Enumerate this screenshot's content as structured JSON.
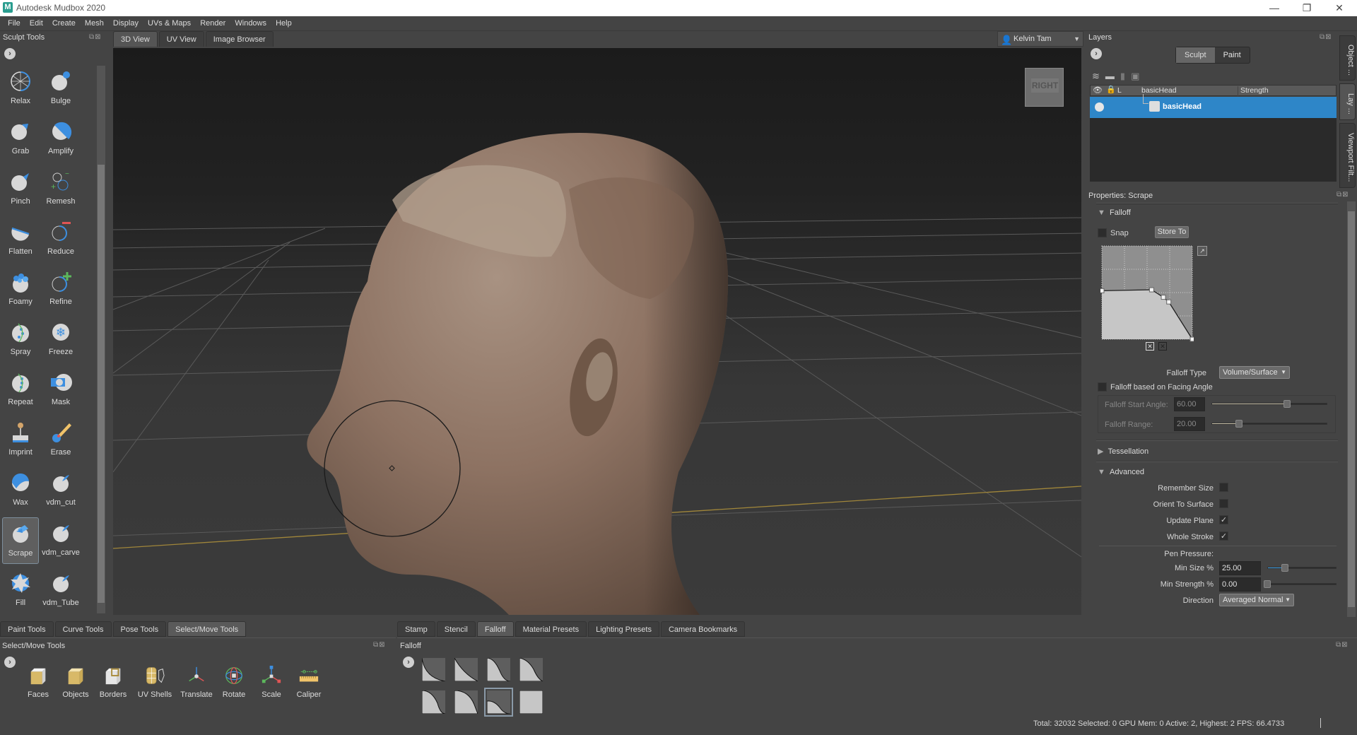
{
  "app": {
    "title": "Autodesk Mudbox 2020",
    "logo_letter": "M",
    "window_controls": {
      "minimize": "—",
      "restore": "❐",
      "close": "✕"
    }
  },
  "menu": [
    "File",
    "Edit",
    "Create",
    "Mesh",
    "Display",
    "UVs & Maps",
    "Render",
    "Windows",
    "Help"
  ],
  "sculpt_tools": {
    "title": "Sculpt Tools",
    "selected": "Scrape",
    "items": [
      {
        "label": "Relax",
        "icon": "relax-icon"
      },
      {
        "label": "Bulge",
        "icon": "bulge-icon"
      },
      {
        "label": "Grab",
        "icon": "grab-icon"
      },
      {
        "label": "Amplify",
        "icon": "amplify-icon"
      },
      {
        "label": "Pinch",
        "icon": "pinch-icon"
      },
      {
        "label": "Remesh",
        "icon": "remesh-icon"
      },
      {
        "label": "Flatten",
        "icon": "flatten-icon"
      },
      {
        "label": "Reduce",
        "icon": "reduce-icon"
      },
      {
        "label": "Foamy",
        "icon": "foamy-icon"
      },
      {
        "label": "Refine",
        "icon": "refine-icon"
      },
      {
        "label": "Spray",
        "icon": "spray-icon"
      },
      {
        "label": "Freeze",
        "icon": "freeze-icon"
      },
      {
        "label": "Repeat",
        "icon": "repeat-icon"
      },
      {
        "label": "Mask",
        "icon": "mask-icon"
      },
      {
        "label": "Imprint",
        "icon": "imprint-icon"
      },
      {
        "label": "Erase",
        "icon": "erase-icon"
      },
      {
        "label": "Wax",
        "icon": "wax-icon"
      },
      {
        "label": "vdm_cut",
        "icon": "vdm-cut-icon"
      },
      {
        "label": "Scrape",
        "icon": "scrape-icon"
      },
      {
        "label": "vdm_carve",
        "icon": "vdm-carve-icon"
      },
      {
        "label": "Fill",
        "icon": "fill-icon"
      },
      {
        "label": "vdm_Tube",
        "icon": "vdm-tube-icon"
      }
    ]
  },
  "viewport": {
    "tabs": [
      {
        "label": "3D View",
        "active": true
      },
      {
        "label": "UV View",
        "active": false
      },
      {
        "label": "Image Browser",
        "active": false
      }
    ],
    "user": "Kelvin Tam",
    "viewcube_label": "RIGHT"
  },
  "layers": {
    "title": "Layers",
    "mode_tabs": [
      {
        "label": "Sculpt",
        "active": true
      },
      {
        "label": "Paint",
        "active": false
      }
    ],
    "columns": [
      "L",
      "basicHead",
      "Strength"
    ],
    "rows": [
      {
        "name": "basicHead",
        "selected": true
      }
    ]
  },
  "side_tabs": [
    "Object ...",
    "Lay ...",
    "Viewport Filt..."
  ],
  "properties": {
    "title": "Properties: Scrape",
    "falloff": {
      "section": "Falloff",
      "snap_label": "Snap",
      "snap_checked": false,
      "store_to_label": "Store To",
      "curve_points": [
        [
          0.0,
          0.52
        ],
        [
          0.55,
          0.53
        ],
        [
          0.68,
          0.45
        ],
        [
          0.74,
          0.4
        ],
        [
          1.0,
          0.0
        ]
      ],
      "falloff_type_label": "Falloff Type",
      "falloff_type_value": "Volume/Surface",
      "facing_angle_label": "Falloff based on Facing Angle",
      "facing_angle_checked": false,
      "start_angle_label": "Falloff Start Angle:",
      "start_angle_value": "60.00",
      "start_angle_fraction": 0.65,
      "range_label": "Falloff Range:",
      "range_value": "20.00",
      "range_fraction": 0.24
    },
    "tessellation": {
      "section": "Tessellation",
      "expanded": false
    },
    "advanced": {
      "section": "Advanced",
      "remember_size": {
        "label": "Remember Size",
        "checked": false
      },
      "orient_to_surface": {
        "label": "Orient To Surface",
        "checked": false
      },
      "update_plane": {
        "label": "Update Plane",
        "checked": true
      },
      "whole_stroke": {
        "label": "Whole Stroke",
        "checked": true
      },
      "pen_pressure_label": "Pen Pressure:",
      "min_size_label": "Min Size %",
      "min_size_value": "25.00",
      "min_size_fraction": 0.25,
      "min_strength_label": "Min Strength %",
      "min_strength_value": "0.00",
      "min_strength_fraction": 0.0,
      "direction_label": "Direction",
      "direction_value": "Averaged Normal"
    }
  },
  "bottom_left": {
    "tabs": [
      {
        "label": "Paint Tools",
        "active": false
      },
      {
        "label": "Curve Tools",
        "active": false
      },
      {
        "label": "Pose Tools",
        "active": false
      },
      {
        "label": "Select/Move Tools",
        "active": true
      }
    ],
    "title": "Select/Move Tools",
    "tools": [
      {
        "label": "Faces",
        "icon": "faces-icon"
      },
      {
        "label": "Objects",
        "icon": "objects-icon"
      },
      {
        "label": "Borders",
        "icon": "borders-icon"
      },
      {
        "label": "UV Shells",
        "icon": "uv-shells-icon"
      },
      {
        "label": "Translate",
        "icon": "translate-icon"
      },
      {
        "label": "Rotate",
        "icon": "rotate-icon"
      },
      {
        "label": "Scale",
        "icon": "scale-icon"
      },
      {
        "label": "Caliper",
        "icon": "caliper-icon"
      }
    ]
  },
  "bottom_right": {
    "tabs": [
      {
        "label": "Stamp",
        "active": false
      },
      {
        "label": "Stencil",
        "active": false
      },
      {
        "label": "Falloff",
        "active": true
      },
      {
        "label": "Material Presets",
        "active": false
      },
      {
        "label": "Lighting Presets",
        "active": false
      },
      {
        "label": "Camera Bookmarks",
        "active": false
      }
    ],
    "title": "Falloff",
    "presets": [
      {
        "name": "falloff-preset-1",
        "selected": false
      },
      {
        "name": "falloff-preset-2",
        "selected": false
      },
      {
        "name": "falloff-preset-3",
        "selected": false
      },
      {
        "name": "falloff-preset-4",
        "selected": false
      },
      {
        "name": "falloff-preset-5",
        "selected": false
      },
      {
        "name": "falloff-preset-6",
        "selected": false
      },
      {
        "name": "falloff-preset-7",
        "selected": true
      },
      {
        "name": "falloff-preset-8",
        "selected": false
      }
    ]
  },
  "status": "Total: 32032  Selected: 0 GPU Mem: 0  Active: 2, Highest: 2  FPS: 66.4733",
  "colors": {
    "accent": "#2e86c8",
    "panel": "#444444",
    "skin": "#8f7362"
  }
}
